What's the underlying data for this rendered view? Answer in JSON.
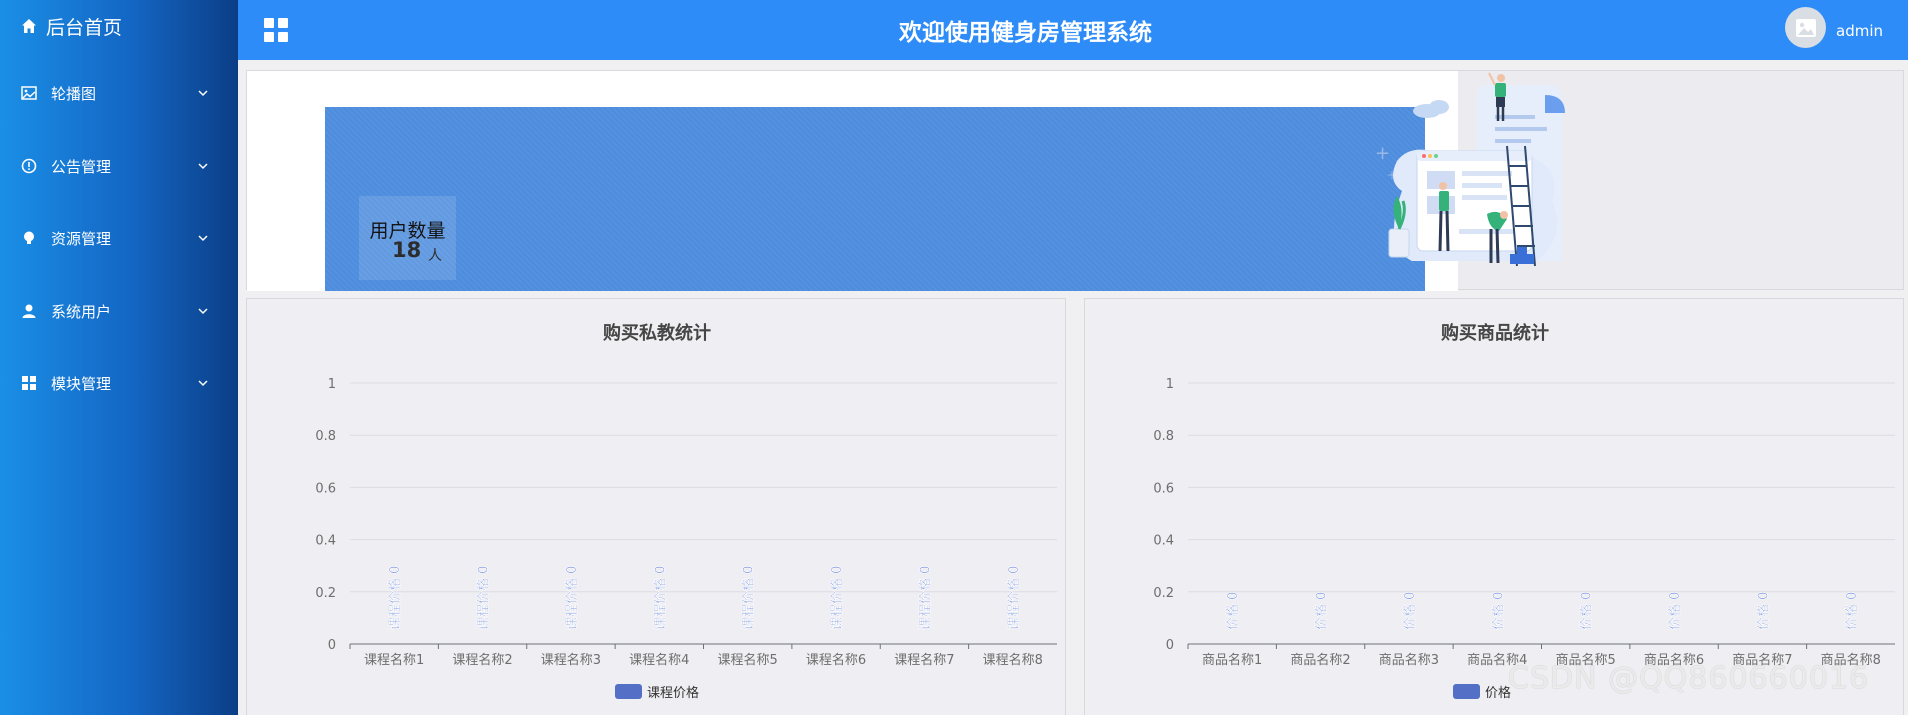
{
  "sidebar": {
    "home": "后台首页",
    "items": [
      {
        "label": "轮播图",
        "icon": "image-icon"
      },
      {
        "label": "公告管理",
        "icon": "info-circle-icon"
      },
      {
        "label": "资源管理",
        "icon": "lightbulb-icon"
      },
      {
        "label": "系统用户",
        "icon": "user-icon"
      },
      {
        "label": "模块管理",
        "icon": "grid-icon"
      }
    ]
  },
  "header": {
    "title": "欢迎使用健身房管理系统",
    "user": "admin"
  },
  "banner": {
    "stat_label": "用户数量",
    "stat_value": "18",
    "stat_unit": "人"
  },
  "colors": {
    "sidebar_from": "#1a8fe6",
    "sidebar_to": "#0b3e86",
    "header": "#2d8cf7",
    "banner_blue": "#4f8fe0",
    "series": "#5470c6"
  },
  "chart_data": [
    {
      "type": "bar",
      "title": "购买私教统计",
      "categories": [
        "课程名称1",
        "课程名称2",
        "课程名称3",
        "课程名称4",
        "课程名称5",
        "课程名称6",
        "课程名称7",
        "课程名称8"
      ],
      "series": [
        {
          "name": "课程价格",
          "values": [
            0,
            0,
            0,
            0,
            0,
            0,
            0,
            0
          ]
        }
      ],
      "data_labels": [
        "课程价格 0",
        "课程价格 0",
        "课程价格 0",
        "课程价格 0",
        "课程价格 0",
        "课程价格 0",
        "课程价格 0",
        "课程价格 0"
      ],
      "yticks": [
        "0",
        "0.2",
        "0.4",
        "0.6",
        "0.8",
        "1"
      ],
      "ylim": [
        0,
        1
      ],
      "grid": true,
      "legend": "bottom"
    },
    {
      "type": "bar",
      "title": "购买商品统计",
      "categories": [
        "商品名称1",
        "商品名称2",
        "商品名称3",
        "商品名称4",
        "商品名称5",
        "商品名称6",
        "商品名称7",
        "商品名称8"
      ],
      "series": [
        {
          "name": "价格",
          "values": [
            0,
            0,
            0,
            0,
            0,
            0,
            0,
            0
          ]
        }
      ],
      "data_labels": [
        "价格 0",
        "价格 0",
        "价格 0",
        "价格 0",
        "价格 0",
        "价格 0",
        "价格 0",
        "价格 0"
      ],
      "yticks": [
        "0",
        "0.2",
        "0.4",
        "0.6",
        "0.8",
        "1"
      ],
      "ylim": [
        0,
        1
      ],
      "grid": true,
      "legend": "bottom"
    }
  ],
  "watermark": "CSDN @QQ860660016"
}
